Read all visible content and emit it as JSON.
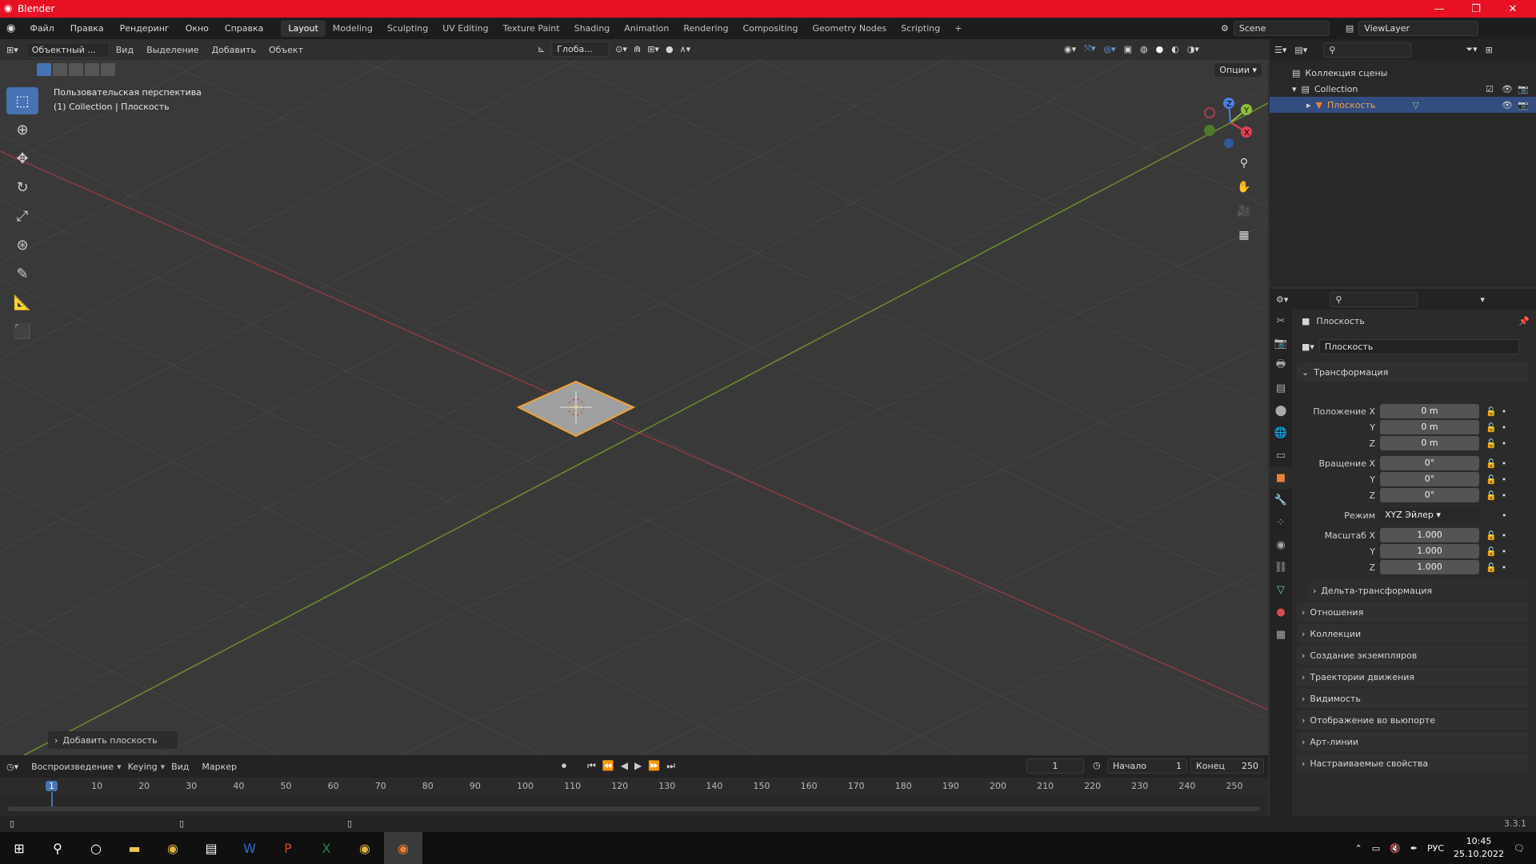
{
  "window": {
    "title": "Blender"
  },
  "menu": [
    "Файл",
    "Правка",
    "Рендеринг",
    "Окно",
    "Справка"
  ],
  "workspaces": [
    "Layout",
    "Modeling",
    "Sculpting",
    "UV Editing",
    "Texture Paint",
    "Shading",
    "Animation",
    "Rendering",
    "Compositing",
    "Geometry Nodes",
    "Scripting"
  ],
  "active_workspace": "Layout",
  "scene": "Scene",
  "view_layer": "ViewLayer",
  "viewport": {
    "mode": "Объектный ...",
    "header_menus": [
      "Вид",
      "Выделение",
      "Добавить",
      "Объект"
    ],
    "transform_orientation": "Глоба...",
    "options": "Опции",
    "view_name": "Пользовательская перспектива",
    "context": "(1) Collection | Плоскость",
    "last_operator": "Добавить плоскость"
  },
  "outliner": {
    "root": "Коллекция сцены",
    "collection": "Collection",
    "object": "Плоскость"
  },
  "properties": {
    "object_name": "Плоскость",
    "object_field": "Плоскость",
    "transform_header": "Трансформация",
    "location_label": "Положение X",
    "rotation_label": "Вращение X",
    "scale_label": "Масштаб X",
    "y_label": "Y",
    "z_label": "Z",
    "mode_label": "Режим",
    "location": [
      "0 m",
      "0 m",
      "0 m"
    ],
    "rotation": [
      "0°",
      "0°",
      "0°"
    ],
    "rotation_mode": "XYZ Эйлер",
    "scale": [
      "1.000",
      "1.000",
      "1.000"
    ],
    "delta": "Дельта-трансформация",
    "sections": [
      "Отношения",
      "Коллекции",
      "Создание экземпляров",
      "Траектории движения",
      "Видимость",
      "Отображение во вьюпорте",
      "Арт-линии",
      "Настраиваемые свойства"
    ]
  },
  "timeline": {
    "menus": [
      "Воспроизведение",
      "Keying",
      "Вид",
      "Маркер"
    ],
    "current_frame": "1",
    "start_label": "Начало",
    "start": "1",
    "end_label": "Конец",
    "end": "250",
    "ticks": [
      "1",
      "10",
      "20",
      "30",
      "40",
      "50",
      "60",
      "70",
      "80",
      "90",
      "100",
      "110",
      "120",
      "130",
      "140",
      "150",
      "160",
      "170",
      "180",
      "190",
      "200",
      "210",
      "220",
      "230",
      "240",
      "250"
    ]
  },
  "status": {
    "version": "3.3.1"
  },
  "taskbar": {
    "lang": "РУС",
    "time": "10:45",
    "date": "25.10.2022"
  }
}
